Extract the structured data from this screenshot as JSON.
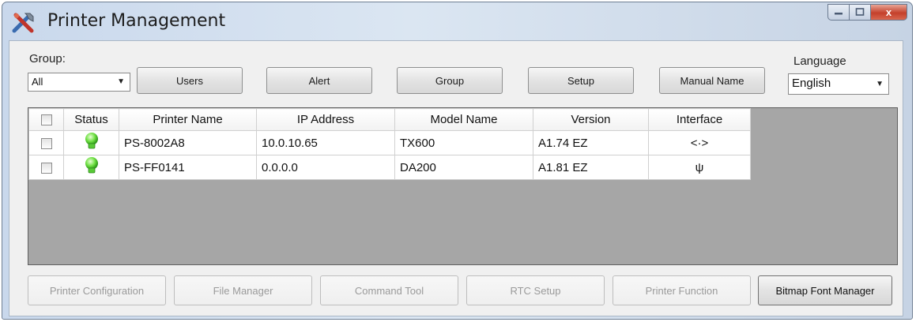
{
  "window": {
    "title": "Printer Management",
    "title_icon": "printer-tools-icon",
    "caption": {
      "minimize_icon": "minimize-icon",
      "maximize_icon": "maximize-icon",
      "close_icon": "close-icon",
      "close_glyph": "x"
    }
  },
  "toolbar": {
    "group_label": "Group:",
    "group_value": "All",
    "buttons": [
      "Users",
      "Alert",
      "Group",
      "Setup",
      "Manual Name"
    ],
    "language_label": "Language",
    "language_value": "English"
  },
  "table": {
    "columns": [
      "",
      "Status",
      "Printer Name",
      "IP Address",
      "Model Name",
      "Version",
      "Interface"
    ],
    "rows": [
      {
        "checked": false,
        "status_icon": "green-bulb-icon",
        "printer_name": "PS-8002A8",
        "ip": "10.0.10.65",
        "model": "TX600",
        "version": "A1.74 EZ",
        "interface": "<·>",
        "interface_icon": "ethernet-icon"
      },
      {
        "checked": false,
        "status_icon": "green-bulb-icon",
        "printer_name": "PS-FF0141",
        "ip": "0.0.0.0",
        "model": "DA200",
        "version": "A1.81 EZ",
        "interface": "ψ",
        "interface_icon": "usb-icon"
      }
    ]
  },
  "bottom_buttons": [
    {
      "label": "Printer Configuration",
      "enabled": false
    },
    {
      "label": "File Manager",
      "enabled": false
    },
    {
      "label": "Command Tool",
      "enabled": false
    },
    {
      "label": "RTC Setup",
      "enabled": false
    },
    {
      "label": "Printer Function",
      "enabled": false
    },
    {
      "label": "Bitmap Font Manager",
      "enabled": true
    }
  ],
  "colors": {
    "status_green": "#5fd63a",
    "grid_background": "#a6a6a6",
    "close_red": "#c4402b"
  }
}
